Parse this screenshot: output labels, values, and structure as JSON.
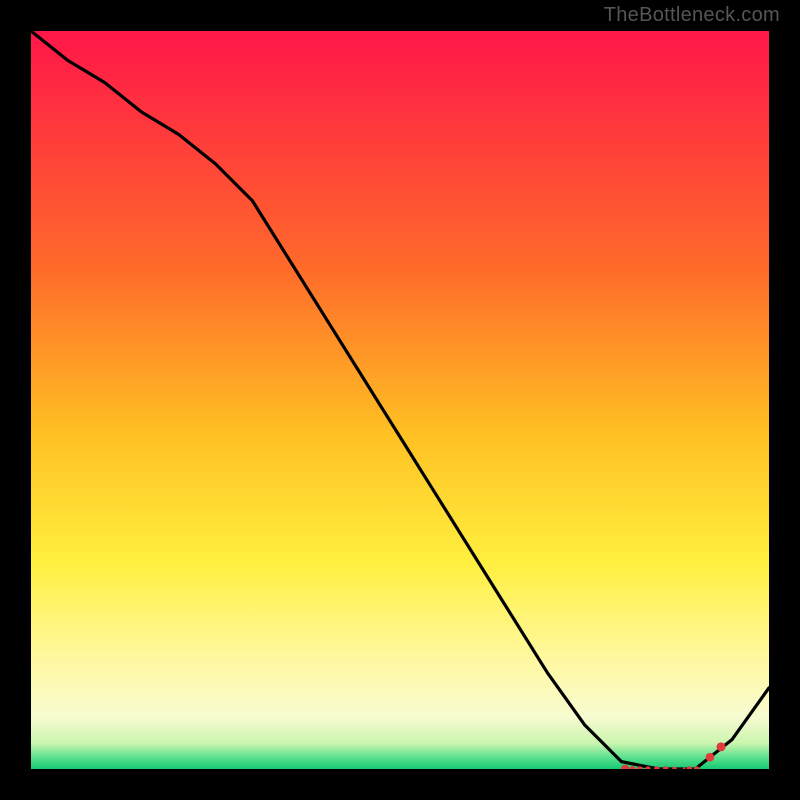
{
  "watermark": "TheBottleneck.com",
  "chart_data": {
    "type": "line",
    "title": "",
    "xlabel": "",
    "ylabel": "",
    "xlim": [
      0,
      100
    ],
    "ylim": [
      0,
      100
    ],
    "grid": false,
    "legend": false,
    "x": [
      0,
      5,
      10,
      15,
      20,
      25,
      30,
      35,
      40,
      45,
      50,
      55,
      60,
      65,
      70,
      75,
      80,
      85,
      90,
      95,
      100
    ],
    "values": [
      100,
      96,
      93,
      89,
      86,
      82,
      77,
      69,
      61,
      53,
      45,
      37,
      29,
      21,
      13,
      6,
      1,
      0,
      0,
      4,
      11
    ],
    "optimal_zone_x": [
      80.5,
      93.5
    ],
    "gradient_stops": [
      {
        "pos": 0.0,
        "color": "#ff1649"
      },
      {
        "pos": 0.32,
        "color": "#ff6a2a"
      },
      {
        "pos": 0.55,
        "color": "#ffc223"
      },
      {
        "pos": 0.72,
        "color": "#ffef3f"
      },
      {
        "pos": 0.85,
        "color": "#fff8a0"
      },
      {
        "pos": 0.93,
        "color": "#f7fbd0"
      },
      {
        "pos": 0.965,
        "color": "#cbf5af"
      },
      {
        "pos": 0.985,
        "color": "#57e08d"
      },
      {
        "pos": 1.0,
        "color": "#16c873"
      }
    ],
    "markers": [
      {
        "x": 80.5,
        "y": 0,
        "r": 4.2
      },
      {
        "x": 81.5,
        "y": 0,
        "r": 3.0
      },
      {
        "x": 82.5,
        "y": 0,
        "r": 2.8
      },
      {
        "x": 83.6,
        "y": 0,
        "r": 2.8
      },
      {
        "x": 84.8,
        "y": 0,
        "r": 2.8
      },
      {
        "x": 86.0,
        "y": 0,
        "r": 2.8
      },
      {
        "x": 87.2,
        "y": 0,
        "r": 2.4
      },
      {
        "x": 88.5,
        "y": 0,
        "r": 1.5
      },
      {
        "x": 89.2,
        "y": 0,
        "r": 2.8
      },
      {
        "x": 90.2,
        "y": 0,
        "r": 2.8
      },
      {
        "x": 92.0,
        "y": 1.6,
        "r": 4.3
      },
      {
        "x": 93.5,
        "y": 3.0,
        "r": 4.5
      }
    ]
  }
}
